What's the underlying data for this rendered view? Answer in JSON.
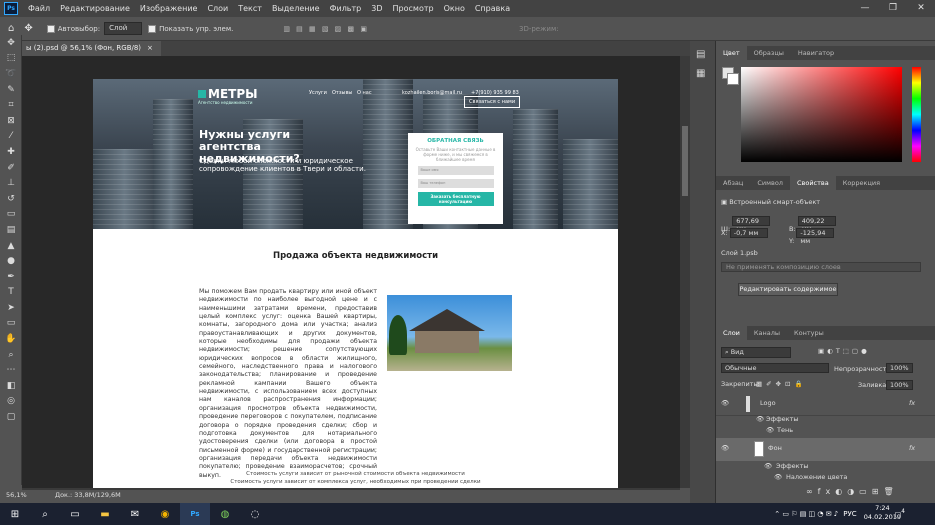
{
  "menu": {
    "items": [
      "Файл",
      "Редактирование",
      "Изображение",
      "Слои",
      "Текст",
      "Выделение",
      "Фильтр",
      "3D",
      "Просмотр",
      "Окно",
      "Справка"
    ],
    "window_controls": [
      "—",
      "❐",
      "✕"
    ]
  },
  "options": {
    "autoselect_label": "Автовыбор:",
    "autoselect_value": "Слой",
    "show_controls": "Показать упр. элем.",
    "mode3d": "3D-режим:"
  },
  "doc_tab": {
    "title": "ы (2).psd @ 56,1% (Фон, RGB/8)",
    "close": "×"
  },
  "site": {
    "logo": "МЕТРЫ",
    "logo_sub": "Агентство недвижимости",
    "nav": [
      "Услуги",
      "Отзывы",
      "О нас"
    ],
    "email": "kozhailen.boris@mail.ru",
    "phone": "+7(910) 935 99 83",
    "call_button": "Связаться с нами",
    "hero_title": "Нужны услуги агентства недвижимости?",
    "hero_sub": "Сделки любой сложности и юридическое сопровождение клиентов в Твери и области.",
    "form_title": "ОБРАТНАЯ СВЯЗЬ",
    "form_desc": "Оставьте Ваши контактные данные в форме ниже, и мы свяжемся в ближайшее время",
    "form_name": "Ваше имя",
    "form_phone": "Ваш телефон",
    "form_button": "Заказать бесплатную консультацию",
    "section_title": "Продажа объекта недвижимости",
    "body_text": "Мы поможем Вам продать квартиру или иной объект недвижимости по наиболее выгодной цене и с наименьшими затратами времени, предоставив целый комплекс услуг: оценка Вашей квартиры, комнаты, загородного дома или участка; анализ правоустанавливающих и других документов, которые необходимы для продажи объекта недвижимости; решение сопутствующих юридических вопросов в области жилищного, семейного, наследственного права и налогового законодательства; планирование и проведение рекламной кампании Вашего объекта недвижимости, с использованием всех доступных нам каналов распространения информации; организация просмотров объекта недвижимости, проведение переговоров с покупателем, подписание договора о порядке проведения сделки; сбор и подготовка документов для нотариального удостоверения сделки (или договора в простой письменной форме) и государственной регистрации; организация передачи объекта недвижимости покупателю; проведение взаиморасчетов; срочный выкуп.",
    "footer1": "Стоимость услуги зависит от рыночной стоимости объекта недвижимости",
    "footer2": "Стоимость услуги зависит от комплекса услуг, необходимых при проведении сделки"
  },
  "status": {
    "zoom": "56,1%",
    "doc": "Док.: 33,8M/129,6M"
  },
  "color_panel": {
    "tabs": [
      "Цвет",
      "Образцы",
      "Навигатор"
    ]
  },
  "props_panel": {
    "tabs": [
      "Абзац",
      "Символ",
      "Свойства",
      "Коррекция"
    ],
    "type": "Встроенный смарт-объект",
    "w_label": "Ш:",
    "w": "677,69 мм",
    "h_label": "В:",
    "h": "409,22 мм",
    "x_label": "X:",
    "x": "-0,7 мм",
    "y_label": "Y:",
    "y": "-125,94 мм",
    "layer_file": "Слой 1.psb",
    "comp": "Не применять композицию слоев",
    "edit_button": "Редактировать содержимое"
  },
  "layers_panel": {
    "tabs": [
      "Слои",
      "Каналы",
      "Контуры"
    ],
    "kind": "Вид",
    "blend": "Обычные",
    "opacity_label": "Непрозрачность:",
    "opacity": "100%",
    "lock_label": "Закрепить:",
    "fill_label": "Заливка:",
    "fill": "100%",
    "layers": [
      {
        "name": "Logo",
        "indent": 0
      },
      {
        "name": "Эффекты",
        "indent": 1
      },
      {
        "name": "Тень",
        "indent": 2
      },
      {
        "name": "Фон",
        "indent": 0
      },
      {
        "name": "Эффекты",
        "indent": 1
      },
      {
        "name": "Наложение цвета",
        "indent": 2
      }
    ]
  },
  "taskbar": {
    "lang": "РУС",
    "time": "7:24",
    "date": "04.02.2019",
    "notif": "4"
  }
}
